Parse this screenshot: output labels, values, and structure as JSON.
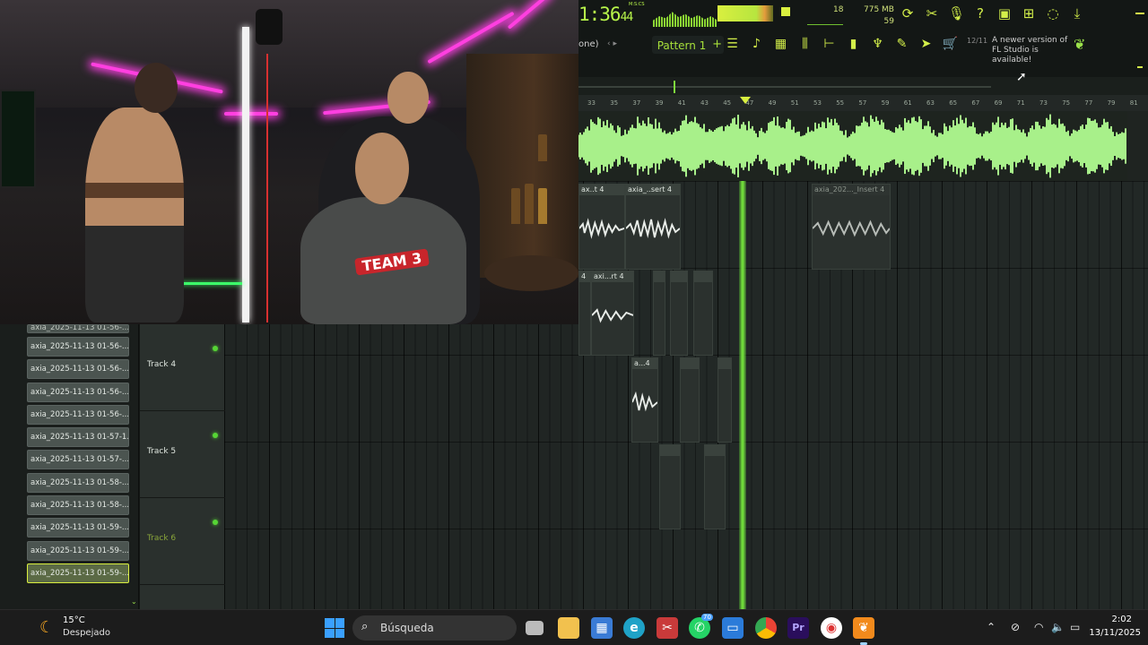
{
  "toolbar": {
    "clock_main": "1:36",
    "clock_small": "44",
    "clock_unit": "M:S:CS",
    "voices": "18",
    "memory": "775 MB",
    "cpu": "59",
    "icons": [
      "refresh-icon",
      "cut-icon",
      "mic-icon",
      "help-icon",
      "save-icon",
      "plugin-icon",
      "chat-icon",
      "download-icon"
    ]
  },
  "pattern": {
    "mode_label": "one)",
    "pattern_name": "Pattern 1",
    "plus": "+",
    "tools": [
      "playlist-icon",
      "piano-roll-icon",
      "channel-rack-icon",
      "mixer-icon",
      "browser-icon",
      "stamp-icon",
      "plugin-picker-icon",
      "touch-keyboard-icon",
      "tempo-tapper-icon",
      "shop-icon"
    ],
    "update_date": "12/11",
    "update_message": "A newer version of FL Studio is available!"
  },
  "ruler": {
    "bars": [
      "33",
      "35",
      "37",
      "39",
      "41",
      "43",
      "45",
      "47",
      "49",
      "51",
      "53",
      "55",
      "57",
      "59",
      "61",
      "63",
      "65",
      "67",
      "69",
      "71",
      "73",
      "75",
      "77",
      "79",
      "81"
    ]
  },
  "clips": {
    "row1": [
      "ax..t 4",
      "axia_..sert 4",
      "axia_202..._Insert 4"
    ],
    "row2": [
      "4",
      "axi...rt 4",
      "",
      "",
      ""
    ],
    "row3": [
      "a...4",
      "",
      ""
    ],
    "row4": [
      "",
      ""
    ]
  },
  "tracks": [
    {
      "name": "Track 4"
    },
    {
      "name": "Track 5"
    },
    {
      "name": "Track 6"
    }
  ],
  "browser": {
    "items": [
      "axia_2025-11-13 01-56-...",
      "axia_2025-11-13 01-56-...",
      "axia_2025-11-13 01-56-...",
      "axia_2025-11-13 01-56-...",
      "axia_2025-11-13 01-57-1...",
      "axia_2025-11-13 01-57-...",
      "axia_2025-11-13 01-58-...",
      "axia_2025-11-13 01-58-...",
      "axia_2025-11-13 01-59-...",
      "axia_2025-11-13 01-59-...",
      "axia_2025-11-13 01-59-..."
    ],
    "top_partial": "axia_2025-11-13 01-56-..."
  },
  "webcam": {
    "shirt_text": "TEAM 3"
  },
  "taskbar": {
    "weather_temp": "15°C",
    "weather_desc": "Despejado",
    "search_placeholder": "Búsqueda",
    "whatsapp_badge": "70",
    "premiere_label": "Pr",
    "time": "2:02",
    "date": "13/11/2025"
  },
  "colors": {
    "accent": "#b7f54a",
    "playhead": "#6fd83a",
    "waveform": "#a8f08a"
  }
}
